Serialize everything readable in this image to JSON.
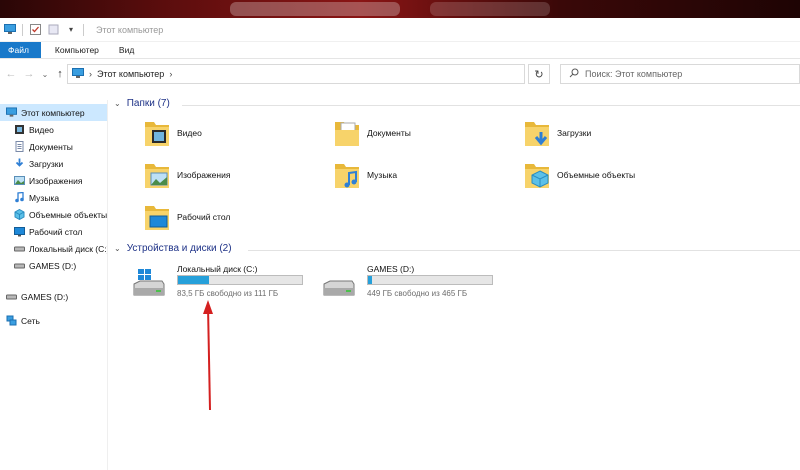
{
  "window": {
    "title": "Этот компьютер"
  },
  "ribbon": {
    "tabs": [
      "Файл",
      "Компьютер",
      "Вид"
    ]
  },
  "address": {
    "crumb": "Этот компьютер",
    "search_placeholder": "Поиск: Этот компьютер"
  },
  "sidebar": {
    "items": [
      {
        "label": "Этот компьютер",
        "icon": "computer-icon",
        "selected": true
      },
      {
        "label": "Видео",
        "icon": "video-icon"
      },
      {
        "label": "Документы",
        "icon": "documents-icon"
      },
      {
        "label": "Загрузки",
        "icon": "downloads-icon"
      },
      {
        "label": "Изображения",
        "icon": "pictures-icon"
      },
      {
        "label": "Музыка",
        "icon": "music-icon"
      },
      {
        "label": "Объемные объекты",
        "icon": "3d-objects-icon"
      },
      {
        "label": "Рабочий стол",
        "icon": "desktop-icon"
      },
      {
        "label": "Локальный диск (C:)",
        "icon": "drive-c-icon"
      },
      {
        "label": "GAMES (D:)",
        "icon": "drive-d-icon"
      },
      {
        "label": "GAMES (D:)",
        "icon": "drive-d-icon"
      },
      {
        "label": "Сеть",
        "icon": "network-icon"
      }
    ]
  },
  "folders_group": {
    "title": "Папки (7)",
    "items": [
      {
        "name": "Видео",
        "icon": "video-folder-icon"
      },
      {
        "name": "Документы",
        "icon": "documents-folder-icon"
      },
      {
        "name": "Загрузки",
        "icon": "downloads-folder-icon"
      },
      {
        "name": "Изображения",
        "icon": "pictures-folder-icon"
      },
      {
        "name": "Музыка",
        "icon": "music-folder-icon"
      },
      {
        "name": "Объемные объекты",
        "icon": "3d-objects-folder-icon"
      },
      {
        "name": "Рабочий стол",
        "icon": "desktop-folder-icon"
      }
    ]
  },
  "drives_group": {
    "title": "Устройства и диски (2)",
    "items": [
      {
        "name": "Локальный диск (C:)",
        "free_text": "83,5 ГБ свободно из 111 ГБ",
        "used_fraction": 0.25,
        "icon": "windows-drive-icon"
      },
      {
        "name": "GAMES (D:)",
        "free_text": "449 ГБ свободно из 465 ГБ",
        "used_fraction": 0.03,
        "icon": "drive-icon"
      }
    ]
  },
  "colors": {
    "accent": "#1979ca",
    "bar_fill": "#26a0da",
    "selected_bg": "#cce8ff",
    "group_title": "#1e3287",
    "annotation_arrow": "#d42020"
  }
}
